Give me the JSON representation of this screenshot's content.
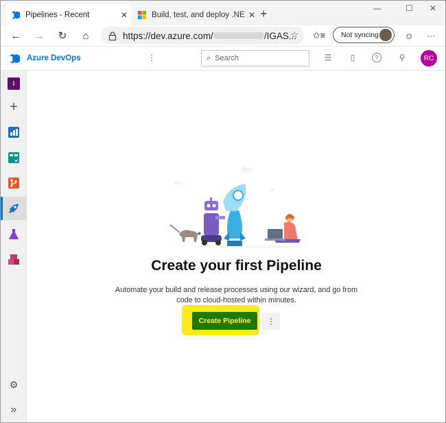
{
  "browser": {
    "tabs": [
      {
        "title": "Pipelines - Recent",
        "close": "✕",
        "favicon": "azure-devops-icon"
      },
      {
        "title": "Build, test, and deploy .NET Core",
        "close": "✕",
        "favicon": "microsoft-icon"
      }
    ],
    "new_tab": "+",
    "window_controls": {
      "minimize": "—",
      "maximize": "☐",
      "close": "✕"
    },
    "nav": {
      "back": "←",
      "forward": "→",
      "refresh": "↻",
      "home": "⌂"
    },
    "address": {
      "prefix": "https://dev.azure.com/",
      "suffix": "/IGAS..."
    },
    "favorite": "☆",
    "favorites_bar": "✩≡",
    "sync_label": "Not syncing",
    "feedback": "☺",
    "menu": "···"
  },
  "header": {
    "brand": "Azure DevOps",
    "more": "⋮",
    "search_placeholder": "Search",
    "search_icon": "⌕",
    "icons": {
      "list": "☰",
      "bag": "▯",
      "help": "?",
      "user_settings": "⚲"
    },
    "avatar_initials": "RC"
  },
  "rail": {
    "project_initial": "I",
    "add": "+",
    "items": [
      "overview",
      "boards",
      "repos",
      "pipelines",
      "test-plans",
      "artifacts"
    ],
    "settings": "⚙",
    "expand": "»"
  },
  "main": {
    "heading": "Create your first Pipeline",
    "description": "Automate your build and release processes using our wizard, and go from code to cloud-hosted within minutes.",
    "create_label": "Create Pipeline",
    "more": "⋮"
  },
  "colors": {
    "accent": "#0078d4",
    "button": "#1e7a00",
    "highlight": "#ffeb1a",
    "avatar": "#b4009e"
  }
}
